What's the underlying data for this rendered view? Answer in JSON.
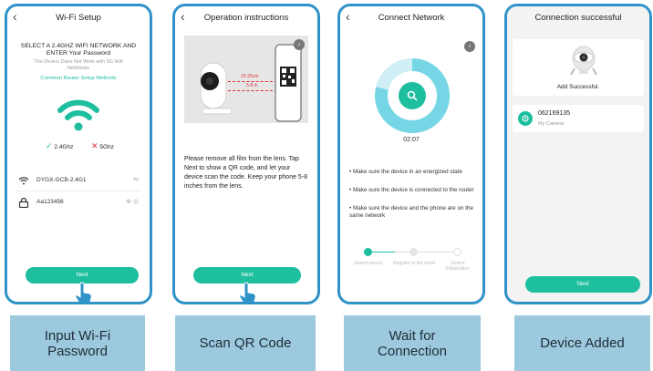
{
  "screens": [
    {
      "title": "Wi-Fi Setup",
      "instruction": "SELECT A 2.4GHZ WIFI NETWORK AND ENTER Your Password",
      "subnote": "The Device Does Not Work with 5G Wifi NetWorks",
      "link": "Common Router Setup Methods",
      "band_ok": "2.4Ghz",
      "band_bad": "5Ghz",
      "ssid": "DYGX-GCB-2.4G1",
      "password": "Aa123456",
      "button": "Next"
    },
    {
      "title": "Operation instructions",
      "distance_cm": "15-25cm",
      "distance_in": "5-8 in",
      "instructions": "Please remove all film from the lens. Tap Next to show a QR code, and let your device scan the code. Keep your phone 5-8 inches from the lens.",
      "button": "Next"
    },
    {
      "title": "Connect Network",
      "timer": "02:07",
      "bullets": [
        "Make sure the device in an energized state",
        "Make sure the device is connected to the router",
        "Make sure the device and the phone are on the same network"
      ],
      "steps": [
        "Search device",
        "Register to the cloud",
        "Device initialization"
      ]
    },
    {
      "title": "Connection successful",
      "added": "Add Successful.",
      "device_id": "062169135",
      "device_name": "My Camera",
      "button": "Next"
    }
  ],
  "captions": [
    "Input Wi-Fi Password",
    "Scan QR Code",
    "Wait for Connection",
    "Device Added"
  ],
  "colors": {
    "frame": "#2f93c8",
    "accent": "#1dbf9f",
    "caption_bg": "#9cc9de",
    "error": "#e0302f"
  }
}
